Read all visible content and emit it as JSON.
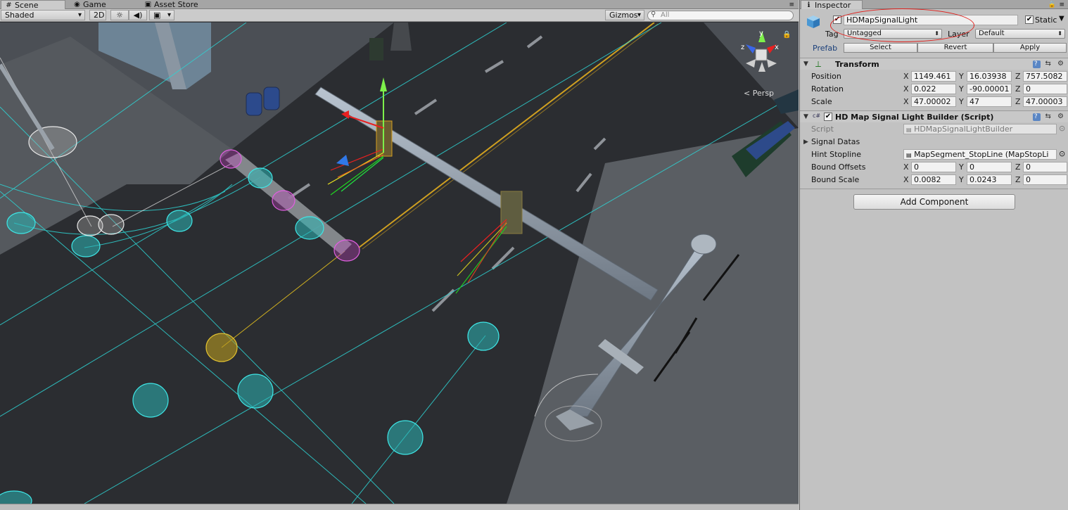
{
  "scene_panel": {
    "tabs": [
      {
        "label": "Scene",
        "icon": "scene-icon"
      },
      {
        "label": "Game",
        "icon": "game-icon"
      },
      {
        "label": "Asset Store",
        "icon": "asset-store-icon"
      }
    ],
    "toolbar": {
      "draw_mode": "Shaded",
      "mode_2d": "2D",
      "gizmos_label": "Gizmos",
      "search_placeholder": "All"
    },
    "persp_label": "< Persp",
    "gizmo_axes": {
      "x": "x",
      "y": "y",
      "z": "z"
    }
  },
  "inspector": {
    "tab_label": "Inspector",
    "object": {
      "name": "HDMapSignalLight",
      "active": true,
      "static_label": "Static",
      "static": true,
      "tag_label": "Tag",
      "tag_value": "Untagged",
      "layer_label": "Layer",
      "layer_value": "Default",
      "prefab_label": "Prefab",
      "prefab_select": "Select",
      "prefab_revert": "Revert",
      "prefab_apply": "Apply"
    },
    "transform": {
      "title": "Transform",
      "position": {
        "label": "Position",
        "x": "1149.461",
        "y": "16.03938",
        "z": "757.5082"
      },
      "rotation": {
        "label": "Rotation",
        "x": "0.022",
        "y": "-90.00001",
        "z": "0"
      },
      "scale": {
        "label": "Scale",
        "x": "47.00002",
        "y": "47",
        "z": "47.00003"
      }
    },
    "script_component": {
      "title": "HD Map Signal Light Builder (Script)",
      "enabled": true,
      "script_label": "Script",
      "script_value": "HDMapSignalLightBuilder",
      "signal_datas_label": "Signal Datas",
      "hint_stopline_label": "Hint Stopline",
      "hint_stopline_value": "MapSegment_StopLine (MapStopLi",
      "bound_offsets": {
        "label": "Bound Offsets",
        "x": "0",
        "y": "0",
        "z": "0"
      },
      "bound_scale": {
        "label": "Bound Scale",
        "x": "0.0082",
        "y": "0.0243",
        "z": "0"
      }
    },
    "axis_labels": {
      "x": "X",
      "y": "Y",
      "z": "Z"
    },
    "add_component_label": "Add Component"
  },
  "colors": {
    "annotation_red": "#e0201c",
    "lane_cyan": "#2ed3d3",
    "stopline_magenta": "#d040d0",
    "road_asphalt": "#2b2d31"
  }
}
